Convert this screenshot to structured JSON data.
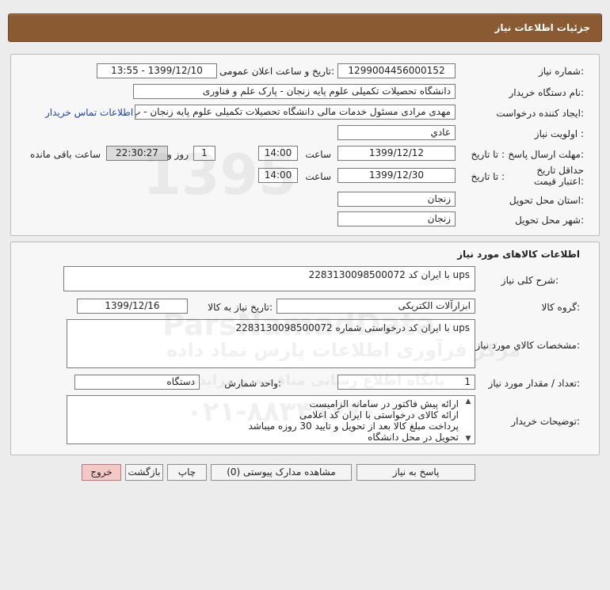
{
  "header": {
    "title": "جزئیات اطلاعات نیاز"
  },
  "info": {
    "need_number_label": "شماره نیاز:",
    "need_number": "1299004456000152",
    "announce_label": "تاریخ و ساعت اعلان عمومی:",
    "announce_value": "1399/12/10 - 13:55",
    "buyer_label": "نام دستگاه خریدار:",
    "buyer": "دانشگاه تحصیلات تکمیلی علوم پایه زنجان - پارک علم و فناوری",
    "creator_label": "ایجاد کننده درخواست:",
    "creator": "مهدی مرادی مسئول خدمات مالی دانشگاه تحصیلات تکمیلی علوم پایه زنجان - پ",
    "contact_link": "اطلاعات تماس خریدار",
    "priority_label": "اولویت نیاز :",
    "priority": "عادي",
    "deadline_label": "مهلت ارسال پاسخ:",
    "to_date_label": "تا تاریخ :",
    "deadline_date": "1399/12/12",
    "time_label": "ساعت",
    "deadline_time": "14:00",
    "days_value": "1",
    "days_label": "روز و",
    "remaining_time": "22:30:27",
    "remaining_label": "ساعت باقی مانده",
    "validity_label": "حداقل تاریخ اعتبار قیمت:",
    "validity_to_label": "تا تاریخ :",
    "validity_date": "1399/12/30",
    "validity_time_label": "ساعت",
    "validity_time": "14:00",
    "province_label": "استان محل تحویل:",
    "province": "زنجان",
    "city_label": "شهر محل تحویل:",
    "city": "زنجان"
  },
  "goods": {
    "section_title": "اطلاعات کالاهای مورد نیاز",
    "summary_label": "شرح کلی نیاز:",
    "summary": "ups با ایران کد 2283130098500072",
    "group_label": "گروه کالا:",
    "group": "ابزارآلات الکتریکی",
    "need_date_label": "تاریخ نیاز به کالا:",
    "need_date": "1399/12/16",
    "specs_label": "مشخصات کالاي مورد نیاز:",
    "specs": "ups با ایران کد درخواستی شماره 2283130098500072",
    "qty_label": "تعداد / مقدار مورد نیاز:",
    "qty": "1",
    "unit_label": "واحد شمارش:",
    "unit": "دستگاه",
    "notes_label": "توضیحات خریدار:",
    "notes": [
      "ارائه پیش فاکتور در سامانه الزامیست",
      "ارائه کالای درخواستی با ایران کد اعلامی",
      "پرداخت مبلغ کالا بعد از تحویل و تایید 30 روزه میباشد",
      "تحویل در محل دانشگاه"
    ]
  },
  "buttons": {
    "reply": "پاسخ به نیاز",
    "attachments": "مشاهده مدارک پیوستی (0)",
    "print": "چاپ",
    "back": "بازگشت",
    "exit": "خروج"
  },
  "watermark": {
    "line1": "ParsNamadData",
    "line2": "مرکز فرآوری اطلاعات پارس نماد داده",
    "line3": "پایگاه اطلاع رسانی مناقصه و مزایده",
    "line4": "۰۲۱-۸۸۳۴۹۶۷۰",
    "line5": "1395"
  },
  "colors": {
    "header": "#8a5a33",
    "link": "#1a3fb0",
    "exit_button": "#f6c7c7"
  }
}
